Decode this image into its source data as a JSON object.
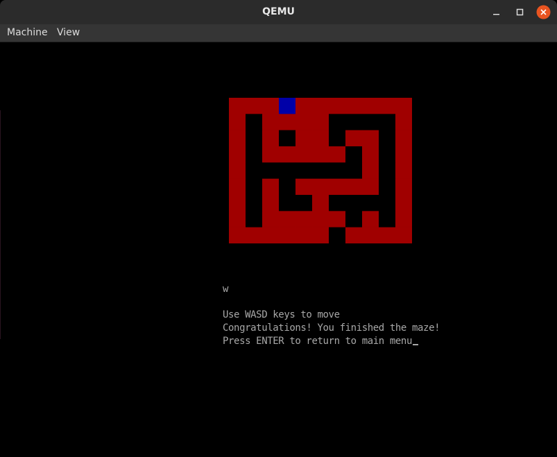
{
  "window": {
    "title": "QEMU",
    "colors": {
      "titlebar": "#2b2b2b",
      "close": "#e95420"
    }
  },
  "menu": {
    "items": [
      {
        "label": "Machine"
      },
      {
        "label": "View"
      }
    ]
  },
  "maze": {
    "rows": 9,
    "cols": 11,
    "wall_color": "#a00000",
    "path_color": "#000000",
    "player_color": "#0000a8",
    "player": {
      "row": 0,
      "col": 3
    },
    "grid": [
      "11111111111",
      "10111100001",
      "10101101101",
      "10111110101",
      "10000000101",
      "10101111101",
      "10100100001",
      "10111110101",
      "11111101111"
    ]
  },
  "console": {
    "last_key": "w",
    "instruction": "Use WASD keys to move",
    "message": "Congratulations! You finished the maze!",
    "prompt": "Press ENTER to return to main menu"
  },
  "icons": {
    "minimize": "minimize-icon",
    "maximize": "maximize-icon",
    "close": "close-icon"
  }
}
